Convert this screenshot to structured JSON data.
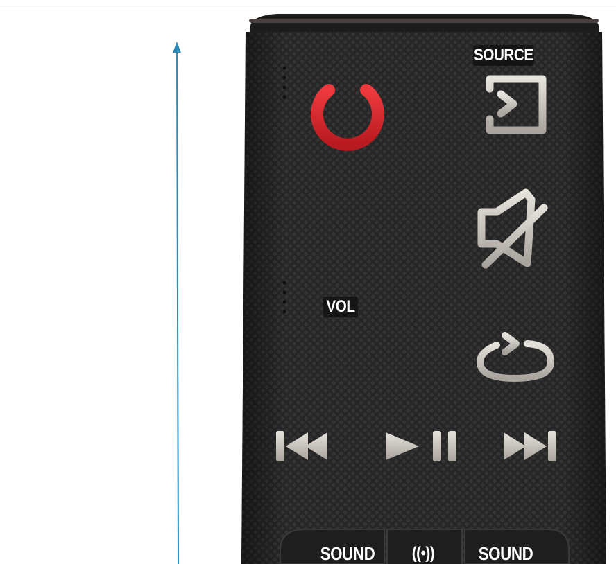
{
  "remote": {
    "source_label": "SOURCE",
    "vol_label": "VOL",
    "bottom_buttons": {
      "sound_left": "SOUND",
      "surround": "((•))",
      "sound_right": "SOUND"
    },
    "buttons": [
      {
        "name": "power-button",
        "icon": "power-icon"
      },
      {
        "name": "source-button",
        "icon": "source-input-icon"
      },
      {
        "name": "volume-up-button",
        "icon": "plus-icon"
      },
      {
        "name": "mute-button",
        "icon": "mute-icon"
      },
      {
        "name": "volume-down-button",
        "icon": "minus-icon"
      },
      {
        "name": "repeat-button",
        "icon": "repeat-icon"
      },
      {
        "name": "previous-button",
        "icon": "skip-previous-icon"
      },
      {
        "name": "play-pause-button",
        "icon": "play-pause-icon"
      },
      {
        "name": "next-button",
        "icon": "skip-next-icon"
      }
    ],
    "colors": {
      "body": "#2a2a2a",
      "button_gray": "#cfcac4",
      "power_red": "#d8262c",
      "pointer_line": "#2d8bb8"
    }
  }
}
